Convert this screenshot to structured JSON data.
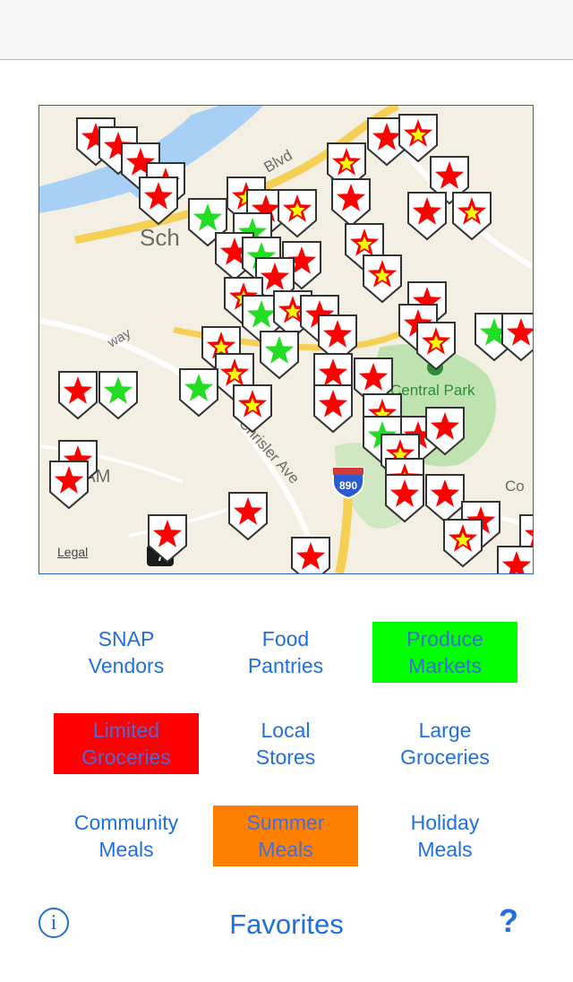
{
  "map": {
    "legal_label": "Legal",
    "labels": {
      "city_fragment": "Sch",
      "dam_fragment": "DAM",
      "boulevard": "Blvd",
      "avenue": "Chrisler Ave",
      "park": "Central Park",
      "interstate_shield": "890",
      "route_shield": "7",
      "way": "way",
      "co": "Co"
    },
    "marker_colors": {
      "red_star": "#ff0000",
      "green_star": "#22dd22",
      "yellow_fill": "#ffff00"
    }
  },
  "categories": [
    {
      "label": "SNAP\nVendors",
      "style": "plain"
    },
    {
      "label": "Food\nPantries",
      "style": "plain"
    },
    {
      "label": "Produce\nMarkets",
      "style": "green"
    },
    {
      "label": "Limited\nGroceries",
      "style": "red"
    },
    {
      "label": "Local\nStores",
      "style": "plain"
    },
    {
      "label": "Large\nGroceries",
      "style": "plain"
    },
    {
      "label": "Community\nMeals",
      "style": "plain"
    },
    {
      "label": "Summer\nMeals",
      "style": "orange"
    },
    {
      "label": "Holiday\nMeals",
      "style": "plain"
    }
  ],
  "footer": {
    "info_icon": "i",
    "favorites_label": "Favorites",
    "help_label": "?"
  }
}
